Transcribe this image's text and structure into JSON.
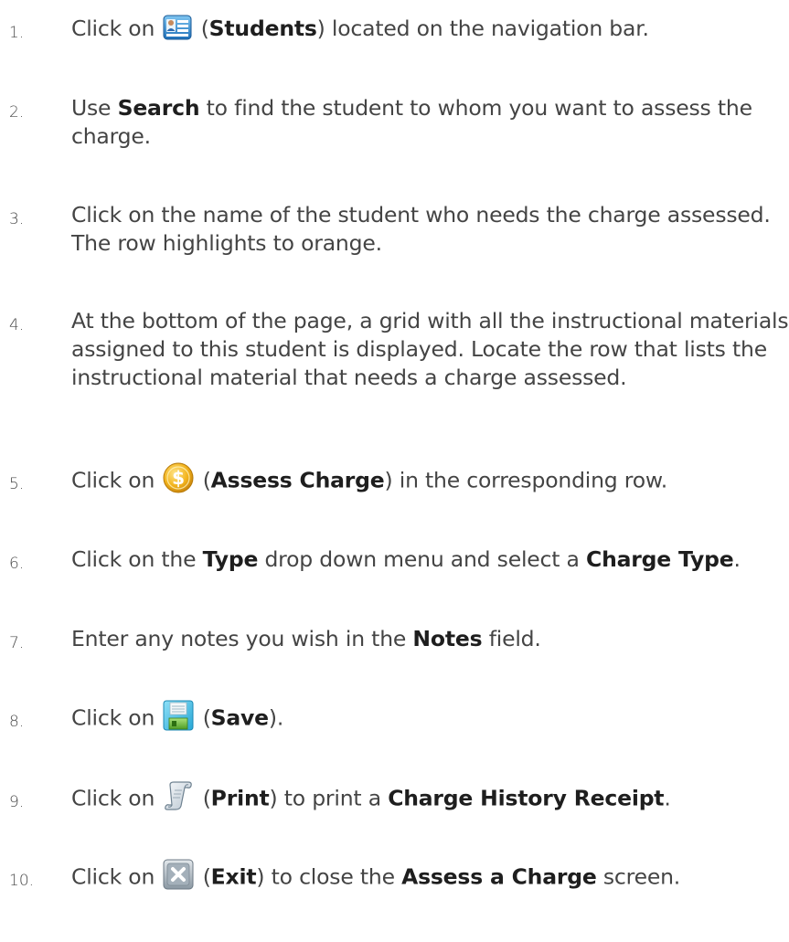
{
  "steps": [
    {
      "number": "1.",
      "pre": "Click on",
      "icon": "students-icon",
      "open_paren": "(",
      "bold": "Students",
      "post": ") located on the navigation bar."
    },
    {
      "number": "2.",
      "pre": "Use",
      "bold": "Search",
      "post": "to find the student to whom you want to assess the charge."
    },
    {
      "number": "3.",
      "text": "Click on the name of the student who needs the charge assessed. The row highlights to orange."
    },
    {
      "number": "4.",
      "text": "At the bottom of the page, a grid with all the instructional materials assigned to this student is displayed. Locate the row that lists the instructional material that needs a charge assessed."
    },
    {
      "number": "5.",
      "pre": "Click on",
      "icon": "dollar-coin-icon",
      "open_paren": "(",
      "bold": "Assess Charge",
      "post": ") in the corresponding row."
    },
    {
      "number": "6.",
      "pre": "Click on the",
      "bold": "Type",
      "mid": "drop down menu and select a",
      "bold2": "Charge Type",
      "post": "."
    },
    {
      "number": "7.",
      "pre": "Enter any notes you wish in the",
      "bold": "Notes",
      "post": "field."
    },
    {
      "number": "8.",
      "pre": "Click on",
      "icon": "floppy-disk-icon",
      "open_paren": "(",
      "bold": "Save",
      "post": ")."
    },
    {
      "number": "9.",
      "pre": "Click on",
      "icon": "scroll-icon",
      "open_paren": "(",
      "bold": "Print",
      "mid": ") to print a",
      "bold2": "Charge History Receipt",
      "post": "."
    },
    {
      "number": "10.",
      "pre": "Click on",
      "icon": "close-x-icon",
      "open_paren": "(",
      "bold": "Exit",
      "mid": ") to close the",
      "bold2": "Assess a Charge",
      "post": "screen."
    }
  ],
  "colors": {
    "text": "#444444",
    "bold": "#1e1e1e",
    "number": "#4a4a4a"
  }
}
